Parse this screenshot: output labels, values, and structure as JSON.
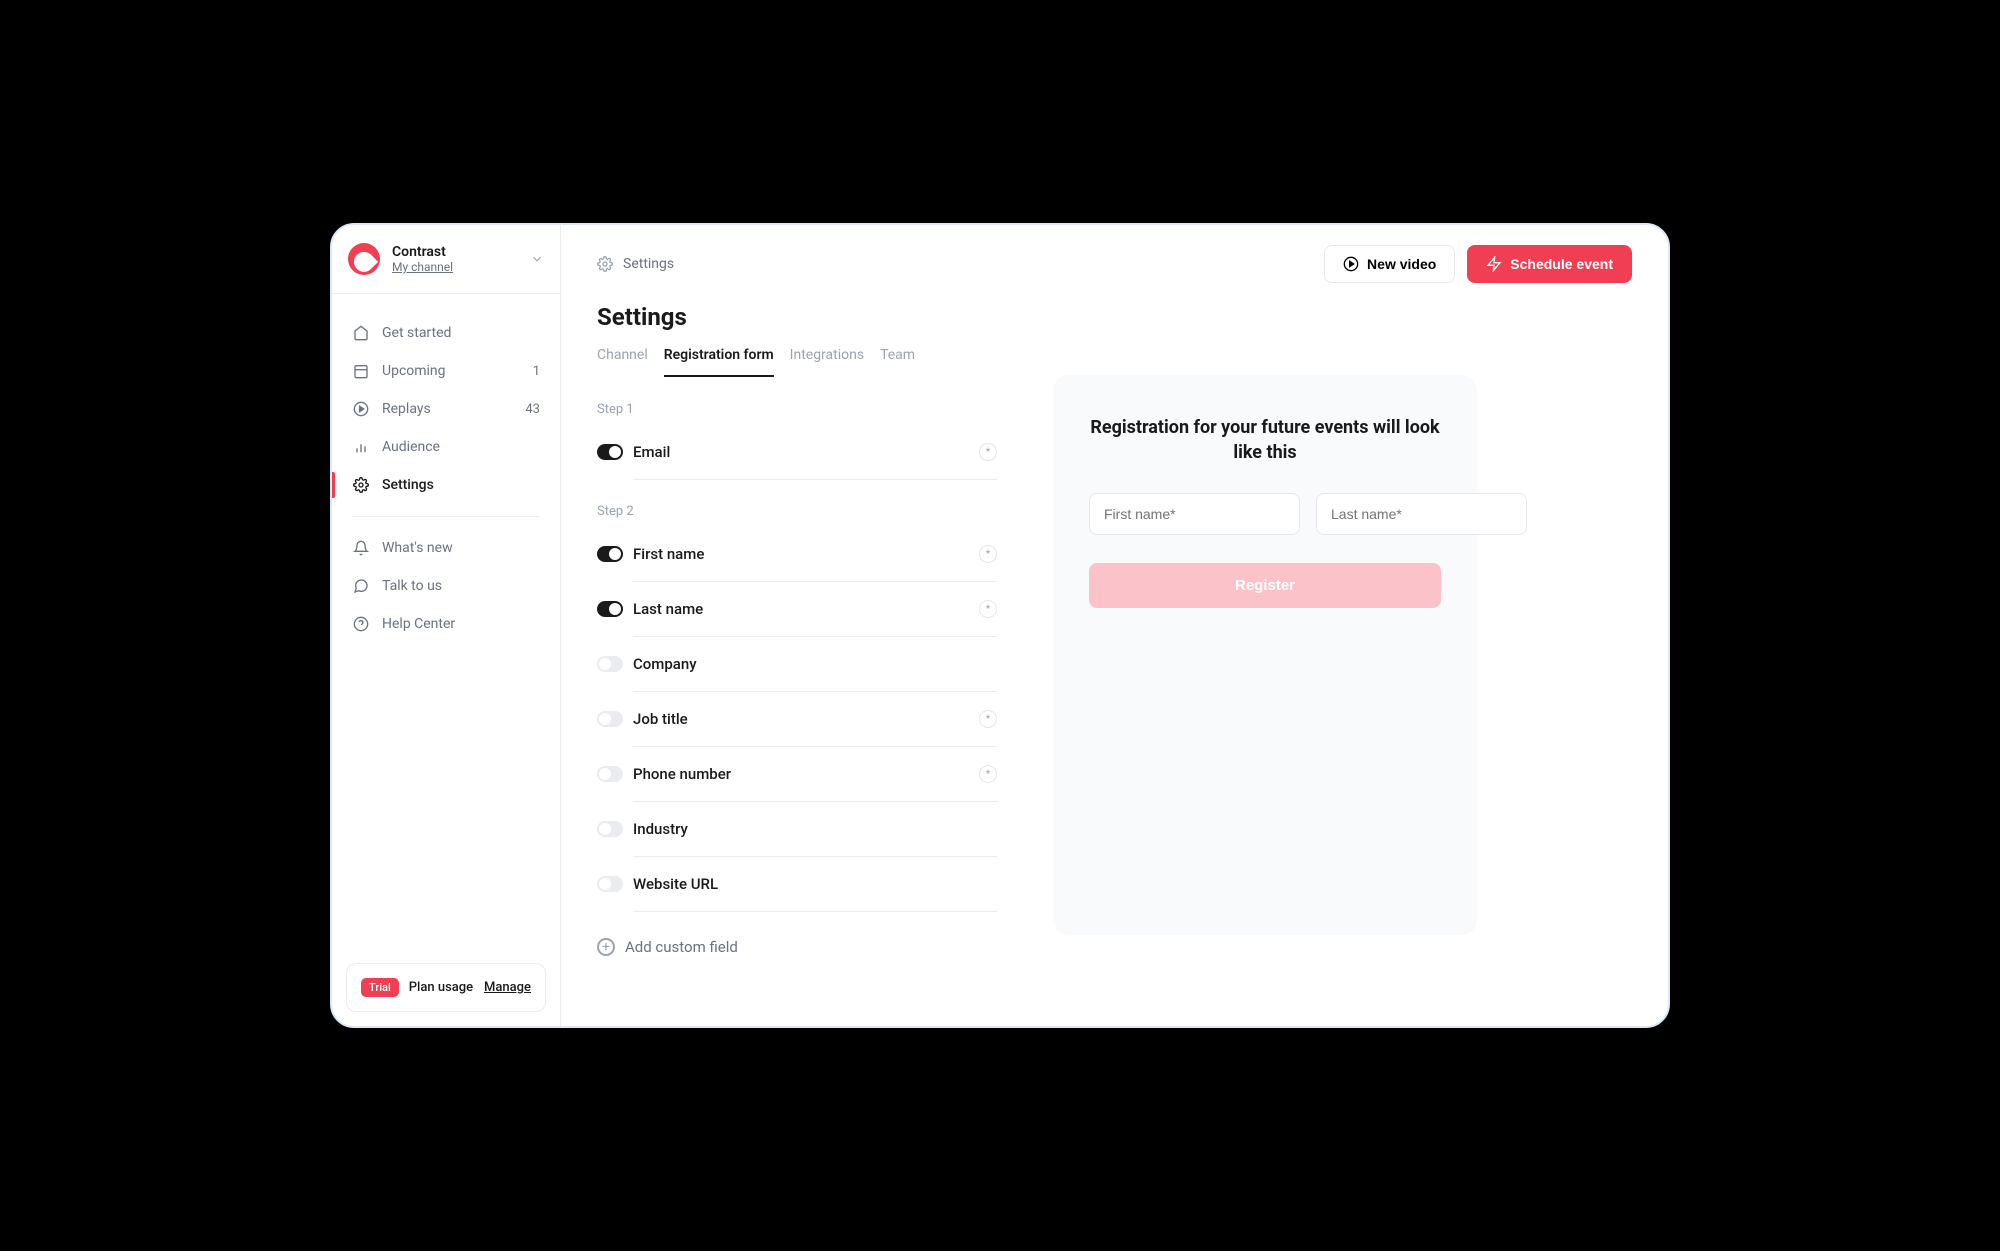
{
  "sidebar": {
    "channelName": "Contrast",
    "channelSub": "My channel",
    "nav": [
      {
        "label": "Get started",
        "badge": ""
      },
      {
        "label": "Upcoming",
        "badge": "1"
      },
      {
        "label": "Replays",
        "badge": "43"
      },
      {
        "label": "Audience",
        "badge": ""
      },
      {
        "label": "Settings",
        "badge": ""
      }
    ],
    "secondary": [
      {
        "label": "What's new"
      },
      {
        "label": "Talk to us"
      },
      {
        "label": "Help Center"
      }
    ],
    "footer": {
      "trial": "Trial",
      "planUsage": "Plan usage",
      "manage": "Manage"
    }
  },
  "topbar": {
    "crumb": "Settings",
    "newVideo": "New video",
    "scheduleEvent": "Schedule event"
  },
  "page": {
    "title": "Settings",
    "tabs": [
      "Channel",
      "Registration form",
      "Integrations",
      "Team"
    ],
    "activeTab": "Registration form",
    "step1Label": "Step 1",
    "step2Label": "Step 2",
    "step1Fields": [
      {
        "label": "Email",
        "on": true,
        "required": true
      }
    ],
    "step2Fields": [
      {
        "label": "First name",
        "on": true,
        "required": true
      },
      {
        "label": "Last name",
        "on": true,
        "required": true
      },
      {
        "label": "Company",
        "on": false,
        "required": false
      },
      {
        "label": "Job title",
        "on": false,
        "required": true
      },
      {
        "label": "Phone number",
        "on": false,
        "required": true
      },
      {
        "label": "Industry",
        "on": false,
        "required": false
      },
      {
        "label": "Website URL",
        "on": false,
        "required": false
      }
    ],
    "addField": "Add custom field"
  },
  "preview": {
    "title": "Registration for your future events will look like this",
    "firstNamePlaceholder": "First name*",
    "lastNamePlaceholder": "Last name*",
    "registerLabel": "Register"
  }
}
